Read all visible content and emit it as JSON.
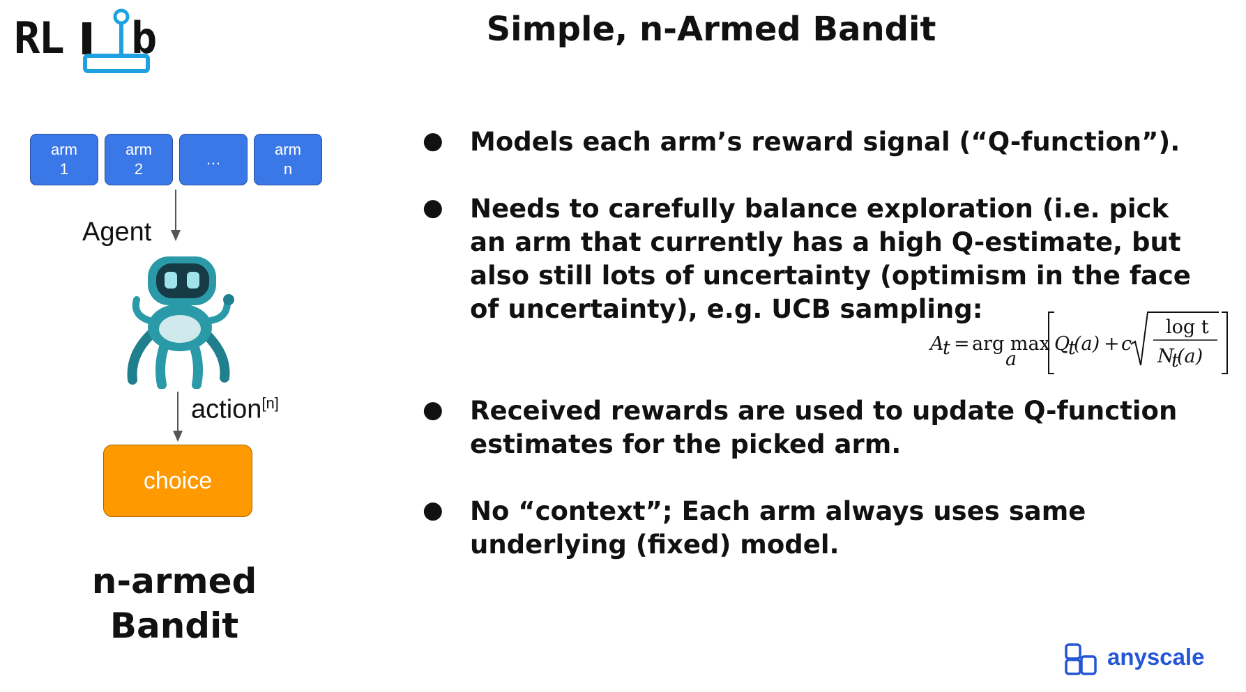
{
  "logo": {
    "text_left": "RL",
    "text_right": "b"
  },
  "title": "Simple, n-Armed Bandit",
  "diagram": {
    "arms": [
      {
        "line1": "arm",
        "line2": "1"
      },
      {
        "line1": "arm",
        "line2": "2"
      },
      {
        "line1": "…",
        "line2": ""
      },
      {
        "line1": "arm",
        "line2": "n"
      }
    ],
    "agent_label": "Agent",
    "action_label": "action",
    "action_superscript": "[n]",
    "choice_label": "choice",
    "bandit_label_line1": "n-armed",
    "bandit_label_line2": "Bandit",
    "colors": {
      "arm": "#3b78e7",
      "choice": "#ff9900",
      "robot": "#2a9aa8"
    }
  },
  "bullets": [
    {
      "text": "Models each arm’s reward signal (“Q-function”)."
    },
    {
      "text": "Needs to carefully balance exploration (i.e. pick an arm that currently has a high Q-estimate, but also still lots of uncertainty (optimism in the face of uncertainty), e.g. UCB sampling:"
    },
    {
      "text": "Received rewards are used to update Q-function estimates for the picked arm."
    },
    {
      "text": "No “context”; Each arm always uses same underlying (fixed) model."
    }
  ],
  "bullet_symbol": "●",
  "formula": {
    "lhs": "A",
    "lhs_sub": "t",
    "eq": "=",
    "op": "arg max",
    "op_sub": "a",
    "q": "Q",
    "q_sub": "t",
    "q_arg": "(a)",
    "plus": "+",
    "c": "c",
    "num": "log t",
    "den": "N",
    "den_sub": "t",
    "den_arg": "(a)"
  },
  "brand": {
    "name": "anyscale",
    "color": "#2355d6"
  }
}
